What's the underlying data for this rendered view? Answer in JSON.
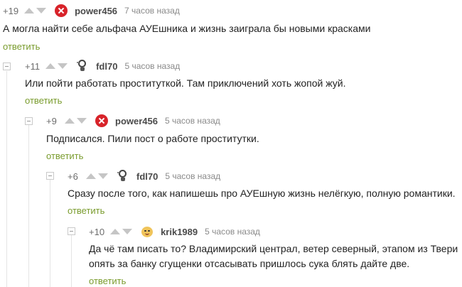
{
  "reply_label": "ответить",
  "colors": {
    "accent": "#7a9c2e",
    "text": "#222222",
    "meta": "#8a8a8a",
    "arrow": "#c5c5c5",
    "ban": "#d8232a"
  },
  "comments": [
    {
      "rating": "+19",
      "author": "power456",
      "time": "7 часов назад",
      "avatar_icon": "ban-icon",
      "text": [
        "А могла найти себе альфача АУЕшника и жизнь заиграла бы новыми красками"
      ]
    },
    {
      "rating": "+11",
      "author": "fdl70",
      "time": "5 часов назад",
      "avatar_icon": "lightbulb-icon",
      "text": [
        "Или пойти работать проституткой. Там приключений хоть жопой жуй."
      ]
    },
    {
      "rating": "+9",
      "author": "power456",
      "time": "5 часов назад",
      "avatar_icon": "ban-icon",
      "text": [
        "Подписался. Пили пост о работе проститутки."
      ]
    },
    {
      "rating": "+6",
      "author": "fdl70",
      "time": "5 часов назад",
      "avatar_icon": "lightbulb-icon",
      "text": [
        "Сразу после того, как напишешь про АУЕшную жизнь нелёгкую, полную романтики."
      ]
    },
    {
      "rating": "+10",
      "author": "krik1989",
      "time": "5 часов назад",
      "avatar_icon": "smiley-face-icon",
      "text": [
        "Да чё там писать то? Владимирский централ, ветер северный, этапом из Твери",
        "опять за банку сгущенки отсасывать пришлось сука блять дайте две."
      ]
    }
  ]
}
